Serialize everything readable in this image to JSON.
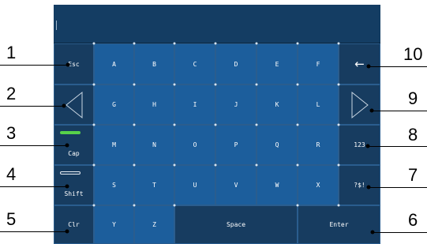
{
  "keyboard": {
    "row1": [
      "Esc",
      "A",
      "B",
      "C",
      "D",
      "E",
      "F"
    ],
    "row2": [
      "G",
      "H",
      "I",
      "J",
      "K",
      "L"
    ],
    "row3": [
      "Cap",
      "M",
      "N",
      "O",
      "P",
      "Q",
      "R",
      "123"
    ],
    "row4": [
      "Shift",
      "S",
      "T",
      "U",
      "V",
      "W",
      "X",
      "?$!"
    ],
    "row5": [
      "Clr",
      "Y",
      "Z",
      "Space",
      "Enter"
    ],
    "backspace": "←"
  },
  "callouts": [
    "1",
    "2",
    "3",
    "4",
    "5",
    "6",
    "7",
    "8",
    "9",
    "10"
  ],
  "colors": {
    "letter_key": "#1c5e9c",
    "function_key": "#173c60",
    "caps_indicator": "#57d14a"
  }
}
